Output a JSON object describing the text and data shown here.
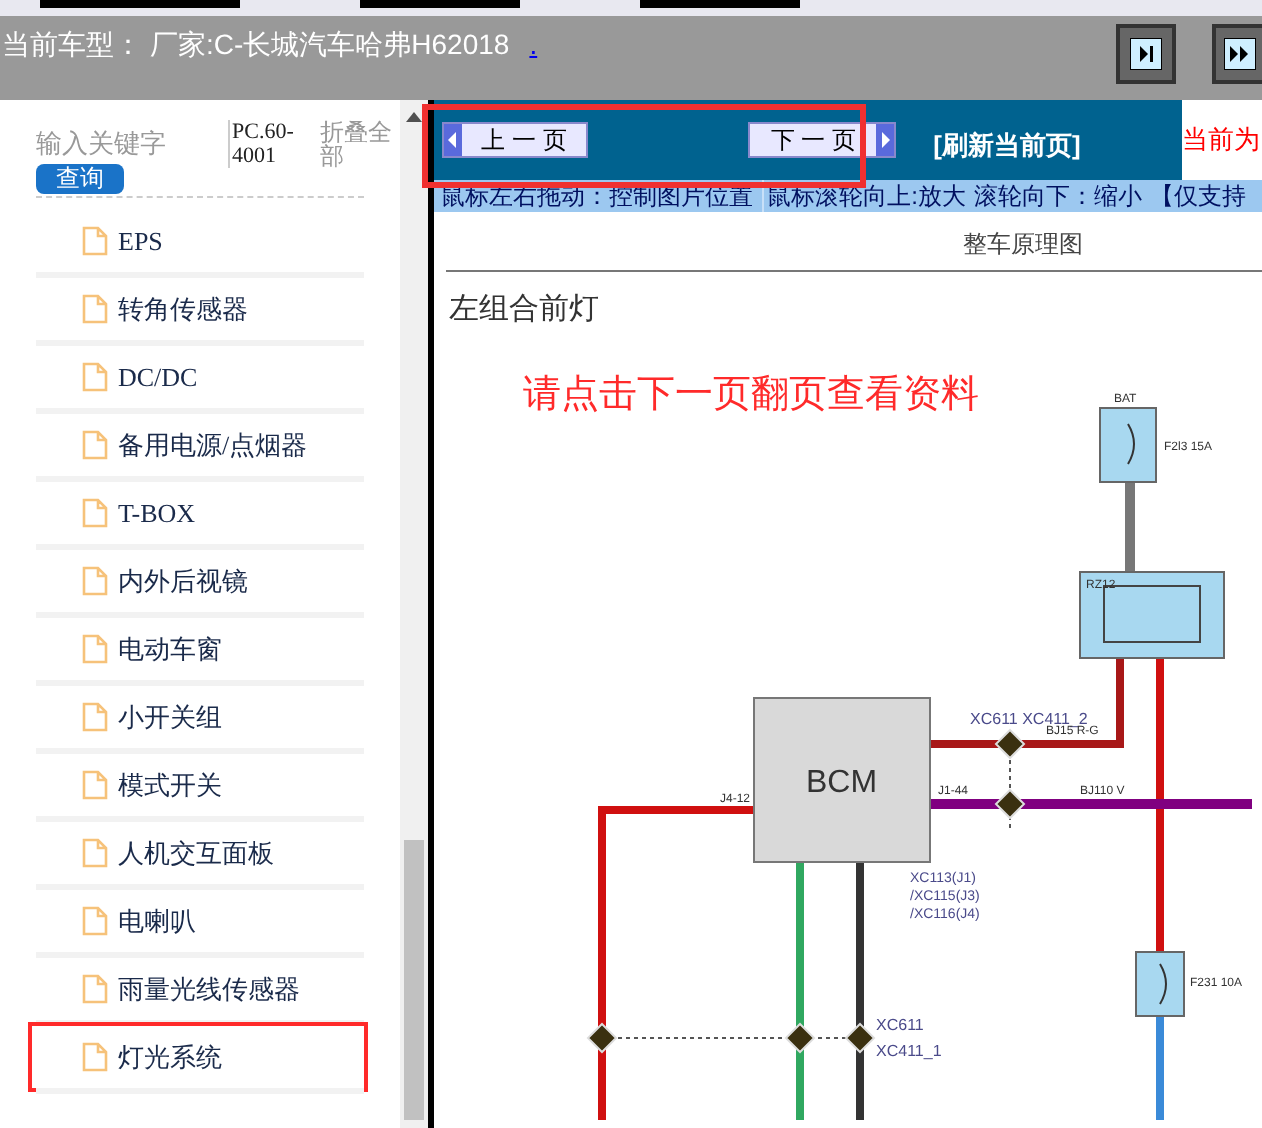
{
  "vehicle_bar": {
    "label": "当前车型：",
    "value": "厂家:C-长城汽车哈弗H62018",
    "link": "."
  },
  "sidebar": {
    "search_placeholder": "输入关键字",
    "search_button": "查询",
    "code": "PC.60-4001",
    "collapse": "折叠全部",
    "items": [
      {
        "label": "EPS",
        "highlighted": false
      },
      {
        "label": "转角传感器",
        "highlighted": false
      },
      {
        "label": "DC/DC",
        "highlighted": false
      },
      {
        "label": "备用电源/点烟器",
        "highlighted": false
      },
      {
        "label": "T-BOX",
        "highlighted": false
      },
      {
        "label": "内外后视镜",
        "highlighted": false
      },
      {
        "label": "电动车窗",
        "highlighted": false
      },
      {
        "label": "小开关组",
        "highlighted": false
      },
      {
        "label": "模式开关",
        "highlighted": false
      },
      {
        "label": "人机交互面板",
        "highlighted": false
      },
      {
        "label": "电喇叭",
        "highlighted": false
      },
      {
        "label": "雨量光线传感器",
        "highlighted": false
      },
      {
        "label": "灯光系统",
        "highlighted": true
      }
    ]
  },
  "viewer": {
    "nav_highlighted": true,
    "prev": "上 一 页",
    "next": "下 一 页",
    "refresh": "[刷新当前页]",
    "current": "当前为",
    "hints": [
      "鼠标左右拖动：控制图片位置",
      "鼠标滚轮向上:放大",
      "滚轮向下：缩小",
      "【仅支持"
    ]
  },
  "document": {
    "header": "整车原理图",
    "title": "左组合前灯",
    "notice": "请点击下一页翻页查看资料",
    "labels": [
      "BAT",
      "F2l3 15A",
      "RZ12",
      "BCM",
      "XC611 XC411_2",
      "BJ15 R-G",
      "J4-12",
      "J1-44",
      "BJ110 V",
      "XC113(J1)",
      "/XC115(J3)",
      "/XC116(J4)",
      "XC611",
      "XC411_1",
      "F231 10A"
    ]
  }
}
